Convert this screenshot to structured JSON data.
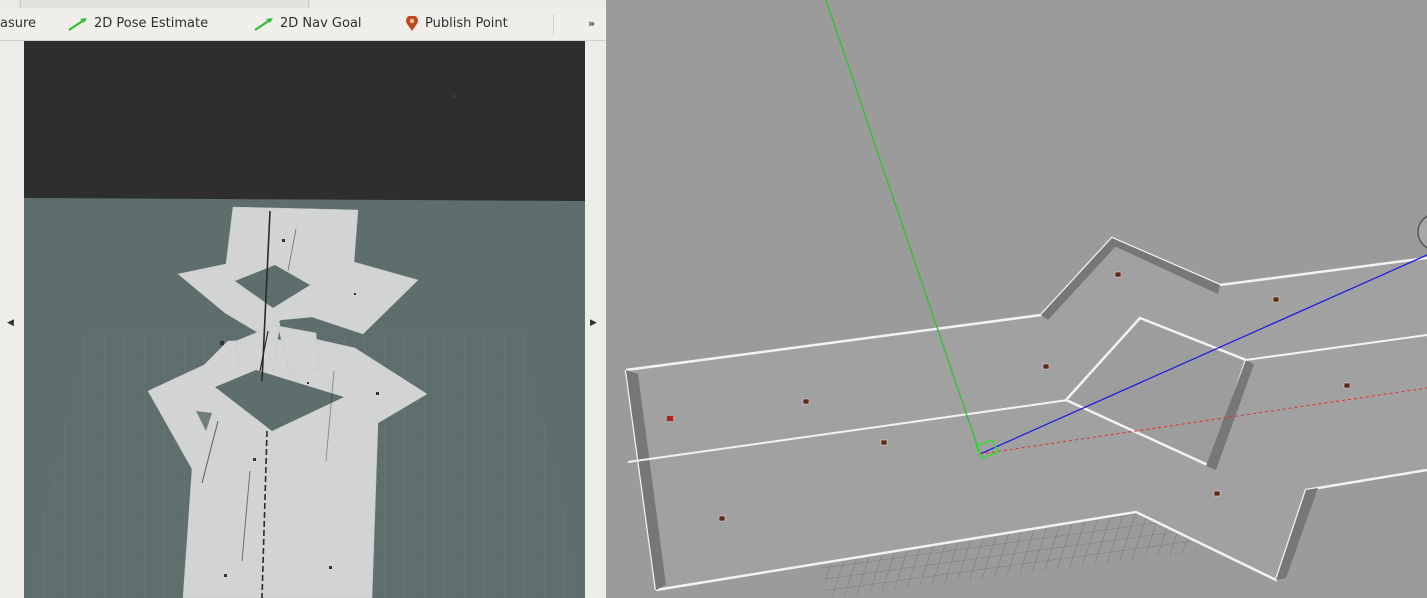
{
  "toolbar": {
    "measure_label": "asure",
    "pose_estimate_label": "2D Pose Estimate",
    "nav_goal_label": "2D Nav Goal",
    "publish_point_label": "Publish Point",
    "more_label": "»"
  },
  "icons": {
    "pose_estimate": "green-arrow-icon",
    "nav_goal": "green-arrow-icon",
    "publish_point": "map-pin-icon",
    "left_scroll": "triangle-left-icon",
    "right_scroll": "triangle-right-icon"
  },
  "colors": {
    "rviz_background": "#2e2e2e",
    "map_background": "#5e6e6c",
    "free_space": "#d2d3d3",
    "gazebo_background": "#9b9b9b",
    "axis_x": "#e03030",
    "axis_y": "#30c030",
    "axis_z": "#2020e0",
    "tool_arrow": "#2fbf2f",
    "pin": "#c0451f"
  }
}
